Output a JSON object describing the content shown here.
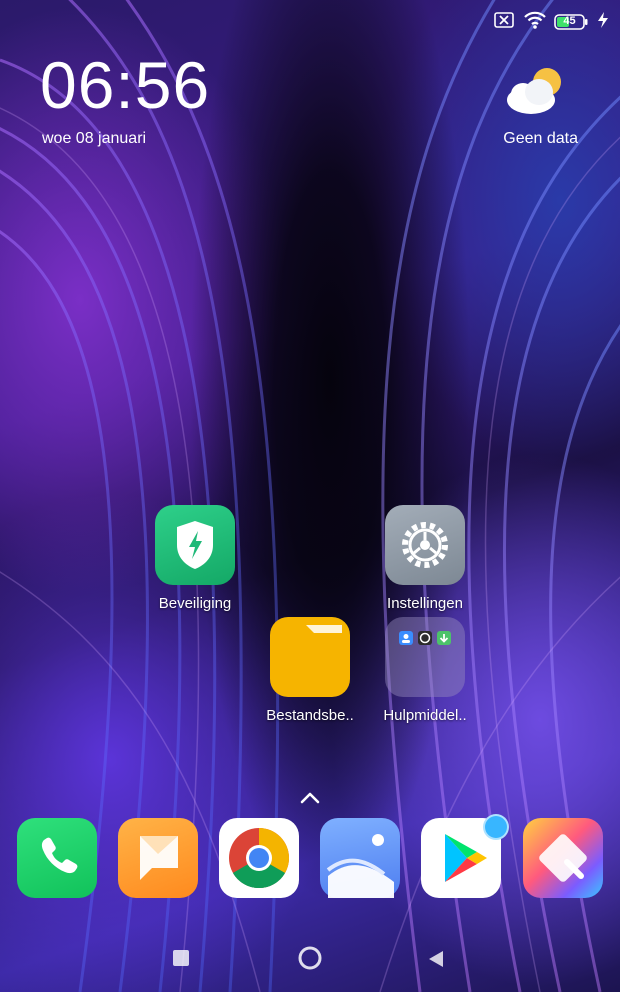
{
  "status_bar": {
    "battery_level": "45",
    "icons": [
      "sim-off-icon",
      "wifi-icon",
      "battery-icon",
      "charging-icon"
    ]
  },
  "clock": {
    "time": "06:56",
    "date": "woe 08 januari"
  },
  "weather": {
    "icon": "partly-cloudy-icon",
    "label": "Geen data"
  },
  "apps": [
    {
      "label": "Beveiliging",
      "icon": "security-shield-icon",
      "color": "#1fb978"
    },
    {
      "label": "Instellingen",
      "icon": "gear-icon",
      "color": "#8d99a6"
    },
    {
      "label": "Bestandsbe..",
      "icon": "folder-icon",
      "color": "#f7b500"
    },
    {
      "label": "Hulpmiddel..",
      "icon": "tools-folder-icon",
      "color": "#6b5fa0"
    }
  ],
  "dock": [
    {
      "icon": "phone-icon",
      "color": "#1fd36a"
    },
    {
      "icon": "messages-icon",
      "color": "#ff9a2e"
    },
    {
      "icon": "chrome-icon",
      "color": "#ffffff"
    },
    {
      "icon": "gallery-icon",
      "color": "#5f8cf2"
    },
    {
      "icon": "play-store-icon",
      "color": "#ffffff"
    },
    {
      "icon": "themes-icon",
      "color": "#ff5a7e"
    }
  ],
  "navigation": [
    "recents-button",
    "home-button",
    "back-button"
  ]
}
